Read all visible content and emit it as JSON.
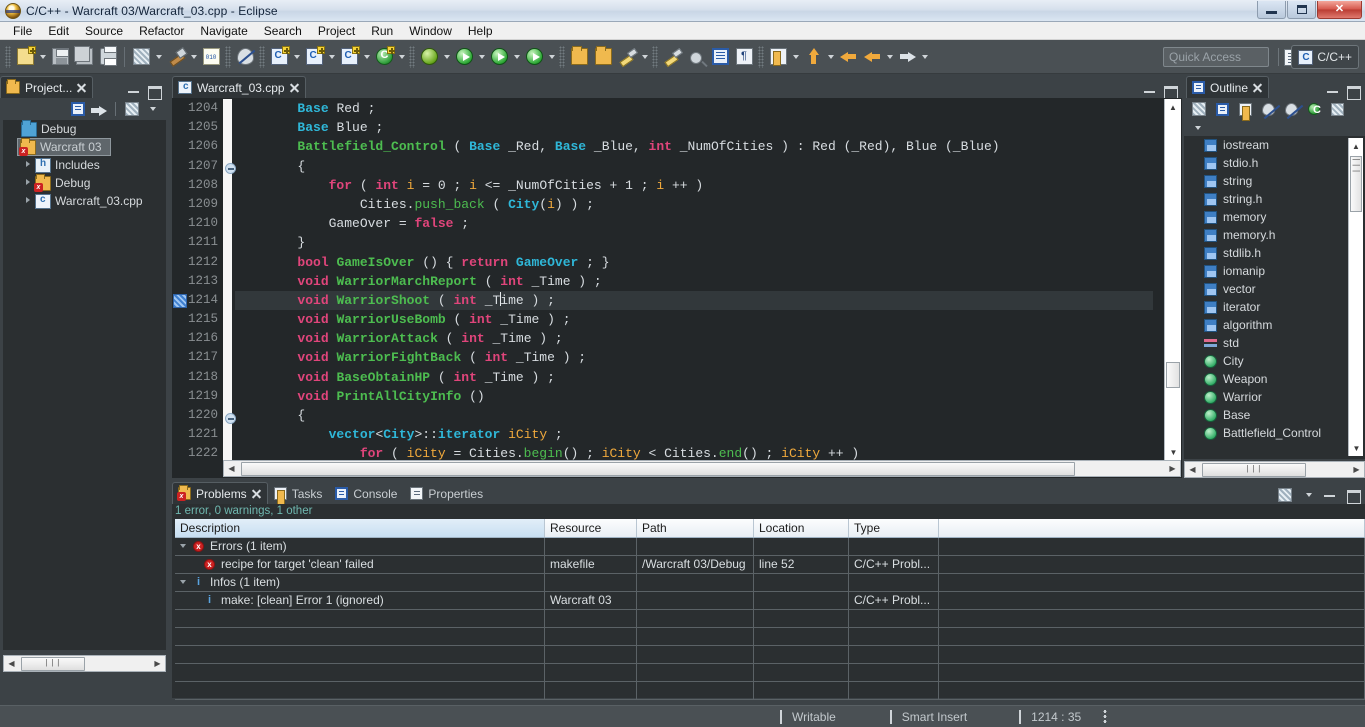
{
  "window": {
    "title": "C/C++ - Warcraft 03/Warcraft_03.cpp - Eclipse",
    "app_icon": "eclipse-icon",
    "minimize": "minimize-button",
    "maximize": "maximize-button",
    "close_label": "✕"
  },
  "menubar": {
    "items": [
      "File",
      "Edit",
      "Source",
      "Refactor",
      "Navigate",
      "Search",
      "Project",
      "Run",
      "Window",
      "Help"
    ]
  },
  "toolbar": {
    "quick_access_placeholder": "Quick Access",
    "perspective_label": "C/C++",
    "buttons": [
      {
        "name": "new-file-button",
        "icon": "new-file-icon"
      },
      {
        "name": "save-button",
        "icon": "save-icon"
      },
      {
        "name": "save-all-button",
        "icon": "save-all-icon"
      },
      {
        "name": "print-button",
        "icon": "print-icon"
      },
      {
        "name": "build-all-button",
        "icon": "build-all-icon"
      },
      {
        "name": "build-button",
        "icon": "hammer-icon"
      },
      {
        "name": "binary-button",
        "icon": "binary-icon"
      },
      {
        "name": "skip-breakpoints-button",
        "icon": "skip-breakpoints-icon"
      },
      {
        "name": "new-cpp-class-button",
        "icon": "new-cpp-class-icon"
      },
      {
        "name": "new-cpp-file-button",
        "icon": "new-cpp-file-icon"
      },
      {
        "name": "new-c-file-button",
        "icon": "new-c-source-icon"
      },
      {
        "name": "new-cpp-project-button",
        "icon": "new-cpp-project-icon"
      },
      {
        "name": "debug-button",
        "icon": "bug-icon"
      },
      {
        "name": "run-button",
        "icon": "run-icon"
      },
      {
        "name": "external-tools-button",
        "icon": "external-tools-icon"
      },
      {
        "name": "run-last-tool-button",
        "icon": "run-last-tool-icon"
      },
      {
        "name": "open-type-button",
        "icon": "open-type-icon"
      },
      {
        "name": "open-resource-button",
        "icon": "open-folder-icon"
      },
      {
        "name": "brush-button",
        "icon": "brush-icon"
      },
      {
        "name": "highlight-button",
        "icon": "highlighter-icon"
      },
      {
        "name": "search-button",
        "icon": "search-icon"
      },
      {
        "name": "toggle-block-selection-button",
        "icon": "block-selection-icon"
      },
      {
        "name": "show-whitespace-button",
        "icon": "pilcrow-icon"
      },
      {
        "name": "next-annotation-button",
        "icon": "next-annotation-icon"
      },
      {
        "name": "previous-annotation-button",
        "icon": "previous-annotation-icon"
      },
      {
        "name": "back-button",
        "icon": "arrow-left-icon"
      },
      {
        "name": "back-history-button",
        "icon": "arrow-left-icon"
      },
      {
        "name": "forward-button",
        "icon": "arrow-right-icon"
      }
    ]
  },
  "project_explorer": {
    "tab_label": "Project...",
    "tools": [
      "collapse-all-icon",
      "link-with-editor-icon",
      "view-menu-icon",
      "view-dropdown-icon"
    ],
    "tree": [
      {
        "label": "Debug",
        "icon": "folder-icon",
        "indent": 1,
        "twisty": "none",
        "selected": false
      },
      {
        "label": "Warcraft 03",
        "icon": "project-error-icon",
        "indent": 0,
        "twisty": "open",
        "selected": true
      },
      {
        "label": "Includes",
        "icon": "includes-icon",
        "indent": 1,
        "twisty": "closed",
        "selected": false
      },
      {
        "label": "Debug",
        "icon": "folder-error-icon",
        "indent": 1,
        "twisty": "closed",
        "selected": false
      },
      {
        "label": "Warcraft_03.cpp",
        "icon": "cpp-file-icon",
        "indent": 1,
        "twisty": "closed",
        "selected": false
      }
    ]
  },
  "editor": {
    "tab_label": "Warcraft_03.cpp",
    "tab_icon": "cpp-file-icon",
    "first_line_number": 1204,
    "fold_lines": [
      1206,
      1219
    ],
    "occurrence_marker_line": 1214,
    "current_line": 1214,
    "lines": [
      {
        "n": 1204,
        "tokens": [
          {
            "t": "        ",
            "c": "pl"
          },
          {
            "t": "Base",
            "c": "ty"
          },
          {
            "t": " Red ;",
            "c": "pl"
          }
        ]
      },
      {
        "n": 1205,
        "tokens": [
          {
            "t": "        ",
            "c": "pl"
          },
          {
            "t": "Base",
            "c": "ty"
          },
          {
            "t": " Blue ;",
            "c": "pl"
          }
        ]
      },
      {
        "n": 1206,
        "tokens": [
          {
            "t": "        ",
            "c": "pl"
          },
          {
            "t": "Battlefield_Control",
            "c": "fn"
          },
          {
            "t": " ( ",
            "c": "pl"
          },
          {
            "t": "Base",
            "c": "ty"
          },
          {
            "t": " _Red, ",
            "c": "pl"
          },
          {
            "t": "Base",
            "c": "ty"
          },
          {
            "t": " _Blue, ",
            "c": "pl"
          },
          {
            "t": "int",
            "c": "kw"
          },
          {
            "t": " _NumOfCities ) : Red (_Red), Blue (_Blue)",
            "c": "pl"
          }
        ]
      },
      {
        "n": 1207,
        "tokens": [
          {
            "t": "        {",
            "c": "pl"
          }
        ]
      },
      {
        "n": 1208,
        "tokens": [
          {
            "t": "            ",
            "c": "pl"
          },
          {
            "t": "for",
            "c": "kw"
          },
          {
            "t": " ( ",
            "c": "pl"
          },
          {
            "t": "int",
            "c": "kw"
          },
          {
            "t": " ",
            "c": "pl"
          },
          {
            "t": "i",
            "c": "var"
          },
          {
            "t": " = ",
            "c": "pl"
          },
          {
            "t": "0",
            "c": "num"
          },
          {
            "t": " ; ",
            "c": "pl"
          },
          {
            "t": "i",
            "c": "var"
          },
          {
            "t": " <= _NumOfCities + ",
            "c": "pl"
          },
          {
            "t": "1",
            "c": "num"
          },
          {
            "t": " ; ",
            "c": "pl"
          },
          {
            "t": "i",
            "c": "var"
          },
          {
            "t": " ++ )",
            "c": "pl"
          }
        ]
      },
      {
        "n": 1209,
        "tokens": [
          {
            "t": "                Cities.",
            "c": "pl"
          },
          {
            "t": "push_back",
            "c": "fn2"
          },
          {
            "t": " ( ",
            "c": "pl"
          },
          {
            "t": "City",
            "c": "ty"
          },
          {
            "t": "(",
            "c": "pl"
          },
          {
            "t": "i",
            "c": "var"
          },
          {
            "t": ") ) ;",
            "c": "pl"
          }
        ]
      },
      {
        "n": 1210,
        "tokens": [
          {
            "t": "            GameOver = ",
            "c": "pl"
          },
          {
            "t": "false",
            "c": "kw"
          },
          {
            "t": " ;",
            "c": "pl"
          }
        ]
      },
      {
        "n": 1211,
        "tokens": [
          {
            "t": "        }",
            "c": "pl"
          }
        ]
      },
      {
        "n": 1212,
        "tokens": [
          {
            "t": "        ",
            "c": "pl"
          },
          {
            "t": "bool",
            "c": "kw"
          },
          {
            "t": " ",
            "c": "pl"
          },
          {
            "t": "GameIsOver",
            "c": "fn"
          },
          {
            "t": " () { ",
            "c": "pl"
          },
          {
            "t": "return",
            "c": "kw"
          },
          {
            "t": " ",
            "c": "pl"
          },
          {
            "t": "GameOver",
            "c": "ty"
          },
          {
            "t": " ; }",
            "c": "pl"
          }
        ]
      },
      {
        "n": 1213,
        "tokens": [
          {
            "t": "        ",
            "c": "pl"
          },
          {
            "t": "void",
            "c": "kw"
          },
          {
            "t": " ",
            "c": "pl"
          },
          {
            "t": "WarriorMarchReport",
            "c": "fn"
          },
          {
            "t": " ( ",
            "c": "pl"
          },
          {
            "t": "int",
            "c": "kw"
          },
          {
            "t": " _Time ) ;",
            "c": "pl"
          }
        ]
      },
      {
        "n": 1214,
        "tokens": [
          {
            "t": "        ",
            "c": "pl"
          },
          {
            "t": "void",
            "c": "kw"
          },
          {
            "t": " ",
            "c": "pl"
          },
          {
            "t": "WarriorShoot",
            "c": "fn"
          },
          {
            "t": " ( ",
            "c": "pl"
          },
          {
            "t": "int",
            "c": "kw"
          },
          {
            "t": " _T",
            "c": "pl"
          },
          {
            "t": "|",
            "c": "cursor"
          },
          {
            "t": "ime ) ;",
            "c": "pl"
          }
        ]
      },
      {
        "n": 1215,
        "tokens": [
          {
            "t": "        ",
            "c": "pl"
          },
          {
            "t": "void",
            "c": "kw"
          },
          {
            "t": " ",
            "c": "pl"
          },
          {
            "t": "WarriorUseBomb",
            "c": "fn"
          },
          {
            "t": " ( ",
            "c": "pl"
          },
          {
            "t": "int",
            "c": "kw"
          },
          {
            "t": " _Time ) ;",
            "c": "pl"
          }
        ]
      },
      {
        "n": 1216,
        "tokens": [
          {
            "t": "        ",
            "c": "pl"
          },
          {
            "t": "void",
            "c": "kw"
          },
          {
            "t": " ",
            "c": "pl"
          },
          {
            "t": "WarriorAttack",
            "c": "fn"
          },
          {
            "t": " ( ",
            "c": "pl"
          },
          {
            "t": "int",
            "c": "kw"
          },
          {
            "t": " _Time ) ;",
            "c": "pl"
          }
        ]
      },
      {
        "n": 1217,
        "tokens": [
          {
            "t": "        ",
            "c": "pl"
          },
          {
            "t": "void",
            "c": "kw"
          },
          {
            "t": " ",
            "c": "pl"
          },
          {
            "t": "WarriorFightBack",
            "c": "fn"
          },
          {
            "t": " ( ",
            "c": "pl"
          },
          {
            "t": "int",
            "c": "kw"
          },
          {
            "t": " _Time ) ;",
            "c": "pl"
          }
        ]
      },
      {
        "n": 1218,
        "tokens": [
          {
            "t": "        ",
            "c": "pl"
          },
          {
            "t": "void",
            "c": "kw"
          },
          {
            "t": " ",
            "c": "pl"
          },
          {
            "t": "BaseObtainHP",
            "c": "fn"
          },
          {
            "t": " ( ",
            "c": "pl"
          },
          {
            "t": "int",
            "c": "kw"
          },
          {
            "t": " _Time ) ;",
            "c": "pl"
          }
        ]
      },
      {
        "n": 1219,
        "tokens": [
          {
            "t": "        ",
            "c": "pl"
          },
          {
            "t": "void",
            "c": "kw"
          },
          {
            "t": " ",
            "c": "pl"
          },
          {
            "t": "PrintAllCityInfo",
            "c": "fn"
          },
          {
            "t": " ()",
            "c": "pl"
          }
        ]
      },
      {
        "n": 1220,
        "tokens": [
          {
            "t": "        {",
            "c": "pl"
          }
        ]
      },
      {
        "n": 1221,
        "tokens": [
          {
            "t": "            ",
            "c": "pl"
          },
          {
            "t": "vector",
            "c": "ty"
          },
          {
            "t": "<",
            "c": "pl"
          },
          {
            "t": "City",
            "c": "ty"
          },
          {
            "t": ">::",
            "c": "pl"
          },
          {
            "t": "iterator",
            "c": "ty"
          },
          {
            "t": " ",
            "c": "pl"
          },
          {
            "t": "iCity",
            "c": "var"
          },
          {
            "t": " ;",
            "c": "pl"
          }
        ]
      },
      {
        "n": 1222,
        "tokens": [
          {
            "t": "                ",
            "c": "pl"
          },
          {
            "t": "for",
            "c": "kw"
          },
          {
            "t": " ( ",
            "c": "pl"
          },
          {
            "t": "iCity",
            "c": "var"
          },
          {
            "t": " = Cities.",
            "c": "pl"
          },
          {
            "t": "begin",
            "c": "fn2"
          },
          {
            "t": "() ; ",
            "c": "pl"
          },
          {
            "t": "iCity",
            "c": "var"
          },
          {
            "t": " < Cities.",
            "c": "pl"
          },
          {
            "t": "end",
            "c": "fn2"
          },
          {
            "t": "() ; ",
            "c": "pl"
          },
          {
            "t": "iCity",
            "c": "var"
          },
          {
            "t": " ++ )",
            "c": "pl"
          }
        ]
      }
    ]
  },
  "outline": {
    "tab_label": "Outline",
    "tools": [
      "view-menu-icon",
      "collapse-all-icon",
      "sort-icon",
      "hide-fields-icon",
      "hide-static-icon",
      "hide-nonpublic-icon",
      "hide-macros-icon",
      "view-dropdown-icon"
    ],
    "items": [
      {
        "label": "iostream",
        "icon": "include-icon"
      },
      {
        "label": "stdio.h",
        "icon": "include-icon"
      },
      {
        "label": "string",
        "icon": "include-icon"
      },
      {
        "label": "string.h",
        "icon": "include-icon"
      },
      {
        "label": "memory",
        "icon": "include-icon"
      },
      {
        "label": "memory.h",
        "icon": "include-icon"
      },
      {
        "label": "stdlib.h",
        "icon": "include-icon"
      },
      {
        "label": "iomanip",
        "icon": "include-icon"
      },
      {
        "label": "vector",
        "icon": "include-icon"
      },
      {
        "label": "iterator",
        "icon": "include-icon"
      },
      {
        "label": "algorithm",
        "icon": "include-icon"
      },
      {
        "label": "std",
        "icon": "namespace-icon"
      },
      {
        "label": "City",
        "icon": "class-icon"
      },
      {
        "label": "Weapon",
        "icon": "class-icon"
      },
      {
        "label": "Warrior",
        "icon": "class-icon"
      },
      {
        "label": "Base",
        "icon": "class-icon"
      },
      {
        "label": "Battlefield_Control",
        "icon": "class-icon"
      }
    ]
  },
  "problems": {
    "tabs": [
      {
        "label": "Problems",
        "icon": "problems-icon",
        "active": true
      },
      {
        "label": "Tasks",
        "icon": "tasks-icon",
        "active": false
      },
      {
        "label": "Console",
        "icon": "console-icon",
        "active": false
      },
      {
        "label": "Properties",
        "icon": "properties-icon",
        "active": false
      }
    ],
    "summary": "1 error, 0 warnings, 1 other",
    "columns": [
      "Description",
      "Resource",
      "Path",
      "Location",
      "Type"
    ],
    "rows": [
      {
        "kind": "group",
        "severity": "error",
        "description": "Errors (1 item)",
        "resource": "",
        "path": "",
        "location": "",
        "type": ""
      },
      {
        "kind": "item",
        "severity": "error",
        "description": "recipe for target 'clean' failed",
        "resource": "makefile",
        "path": "/Warcraft 03/Debug",
        "location": "line 52",
        "type": "C/C++ Probl..."
      },
      {
        "kind": "group",
        "severity": "info",
        "description": "Infos (1 item)",
        "resource": "",
        "path": "",
        "location": "",
        "type": ""
      },
      {
        "kind": "item",
        "severity": "info",
        "description": "make: [clean] Error 1 (ignored)",
        "resource": "Warcraft 03",
        "path": "",
        "location": "",
        "type": "C/C++ Probl..."
      }
    ]
  },
  "statusbar": {
    "writable": "Writable",
    "insert_mode": "Smart Insert",
    "position": "1214 : 35"
  },
  "colors": {
    "keyword": "#e0457b",
    "type": "#2fb7d8",
    "function": "#4dbd50",
    "variable": "#f0a93c",
    "plain": "#d8dde1",
    "editor_bg": "#232729",
    "panel_bg": "#3c4246",
    "accent_error": "#cc2222",
    "accent_info": "#5aa3e0",
    "summary_text": "#6fb8b0"
  }
}
